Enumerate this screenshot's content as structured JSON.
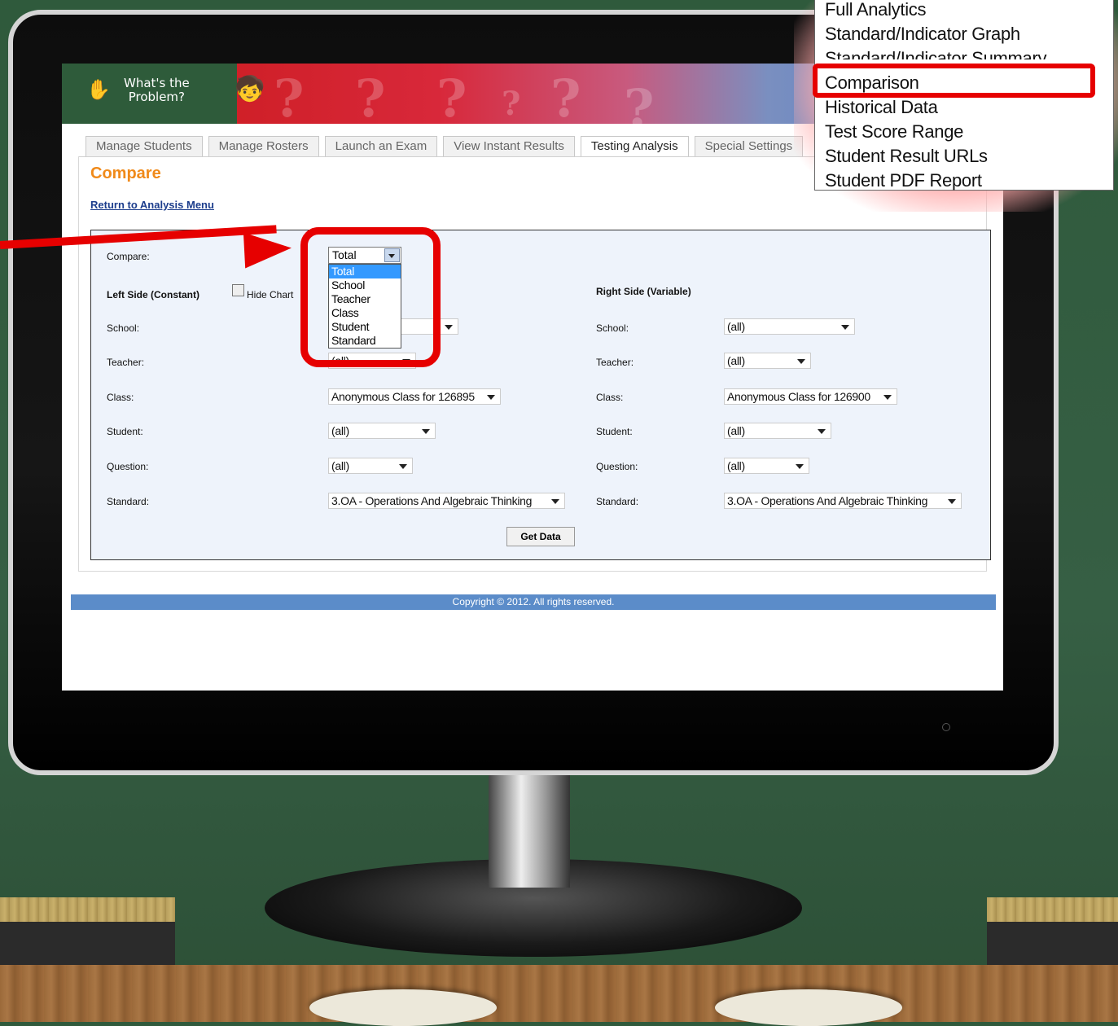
{
  "site": {
    "logo_text_line1": "What's the",
    "logo_text_line2": "Problem?"
  },
  "tabs": [
    {
      "label": "Manage Students",
      "active": false
    },
    {
      "label": "Manage Rosters",
      "active": false
    },
    {
      "label": "Launch an Exam",
      "active": false
    },
    {
      "label": "View Instant Results",
      "active": false
    },
    {
      "label": "Testing Analysis",
      "active": true
    },
    {
      "label": "Special Settings",
      "active": false
    }
  ],
  "page": {
    "title": "Compare",
    "return_link": "Return to Analysis Menu"
  },
  "form": {
    "compare_label": "Compare:",
    "compare_value": "Total",
    "compare_options": [
      "Total",
      "School",
      "Teacher",
      "Class",
      "Student",
      "Standard"
    ],
    "left_heading": "Left Side (Constant)",
    "hide_chart_label": "Hide Chart",
    "right_heading": "Right Side (Variable)",
    "left": {
      "school_label": "School:",
      "school_value": "",
      "teacher_label": "Teacher:",
      "teacher_value": "(all)",
      "class_label": "Class:",
      "class_value": "Anonymous Class for 126895",
      "student_label": "Student:",
      "student_value": "(all)",
      "question_label": "Question:",
      "question_value": "(all)",
      "standard_label": "Standard:",
      "standard_value": "3.OA - Operations And Algebraic Thinking"
    },
    "right": {
      "school_label": "School:",
      "school_value": "(all)",
      "teacher_label": "Teacher:",
      "teacher_value": "(all)",
      "class_label": "Class:",
      "class_value": "Anonymous Class for 126900",
      "student_label": "Student:",
      "student_value": "(all)",
      "question_label": "Question:",
      "question_value": "(all)",
      "standard_label": "Standard:",
      "standard_value": "3.OA - Operations And Algebraic Thinking"
    },
    "get_data_label": "Get Data"
  },
  "footer": {
    "copyright": "Copyright © 2012. All rights reserved."
  },
  "analysis_menu": {
    "items": [
      "Full Analytics",
      "Standard/Indicator Graph",
      "Standard/Indicator Summary",
      "Comparison",
      "Historical Data",
      "Test Score Range",
      "Student Result URLs",
      "Student PDF Report"
    ],
    "highlighted": "Comparison"
  },
  "colors": {
    "accent_orange": "#f08a1a",
    "highlight_red": "#e60000",
    "link_blue": "#1c3d8c",
    "footer_blue": "#5b8cc9",
    "chalkboard_green": "#365f44"
  }
}
